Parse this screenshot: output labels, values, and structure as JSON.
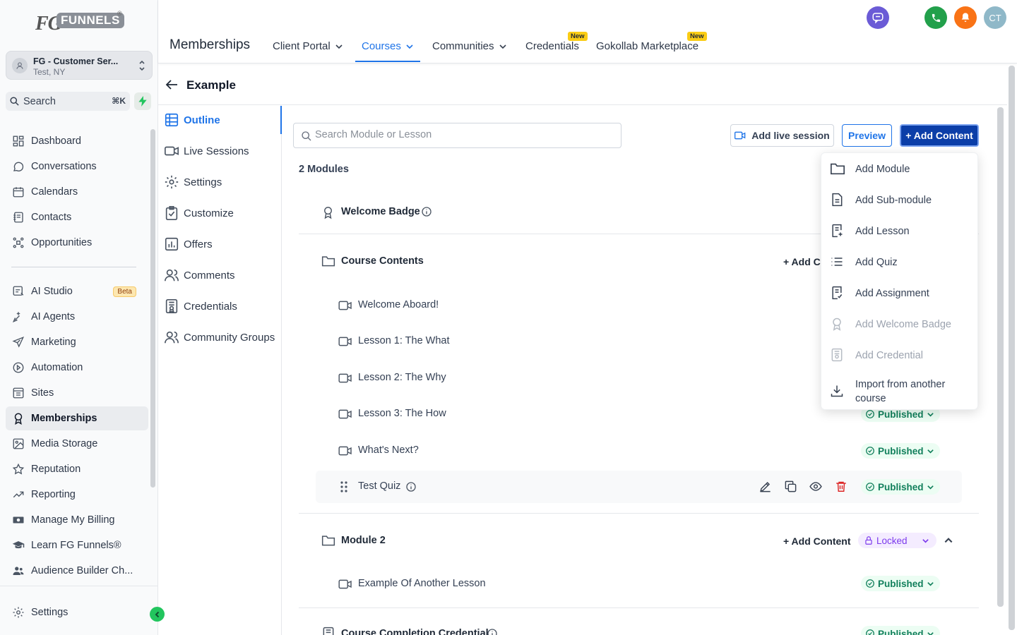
{
  "brand": {
    "fg": "FG",
    "funnels": "FUNNELS",
    "reg": "®"
  },
  "account": {
    "name": "FG - Customer Ser...",
    "location": "Test, NY"
  },
  "sidebar_search": {
    "label": "Search",
    "shortcut": "⌘K"
  },
  "sidebar": {
    "items": [
      {
        "label": "Dashboard",
        "icon": "dashboard-icon"
      },
      {
        "label": "Conversations",
        "icon": "chat-icon"
      },
      {
        "label": "Calendars",
        "icon": "calendar-icon"
      },
      {
        "label": "Contacts",
        "icon": "contacts-icon"
      },
      {
        "label": "Opportunities",
        "icon": "opportunities-icon"
      },
      {
        "label": "AI Studio",
        "icon": "ai-studio-icon",
        "badge": "Beta"
      },
      {
        "label": "AI Agents",
        "icon": "sparkle-icon"
      },
      {
        "label": "Marketing",
        "icon": "send-icon"
      },
      {
        "label": "Automation",
        "icon": "automation-icon"
      },
      {
        "label": "Sites",
        "icon": "sites-icon"
      },
      {
        "label": "Memberships",
        "icon": "award-icon",
        "active": true
      },
      {
        "label": "Media Storage",
        "icon": "image-icon"
      },
      {
        "label": "Reputation",
        "icon": "star-icon"
      },
      {
        "label": "Reporting",
        "icon": "trend-icon"
      },
      {
        "label": "Manage My Billing",
        "icon": "money-icon"
      },
      {
        "label": "Learn FG Funnels®",
        "icon": "graduation-cap-icon"
      },
      {
        "label": "Audience Builder Ch...",
        "icon": "users-icon"
      }
    ],
    "settings": "Settings"
  },
  "topbar": {
    "title": "Memberships",
    "tabs": [
      {
        "label": "Client Portal",
        "dropdown": true
      },
      {
        "label": "Courses",
        "dropdown": true,
        "active": true
      },
      {
        "label": "Communities",
        "dropdown": true
      },
      {
        "label": "Credentials",
        "badge": "New"
      },
      {
        "label": "Gokollab Marketplace",
        "badge": "New"
      }
    ],
    "avatar_initials": "CT",
    "colors": {
      "chat": "#6b5bd6",
      "phone": "#22a04b",
      "bell": "#f97316",
      "avatar": "#8fb8c8"
    }
  },
  "course": {
    "title": "Example",
    "nav": [
      {
        "label": "Outline",
        "icon": "outline-icon",
        "active": true
      },
      {
        "label": "Live Sessions",
        "icon": "video-icon"
      },
      {
        "label": "Settings",
        "icon": "gear-icon"
      },
      {
        "label": "Customize",
        "icon": "clipboard-check-icon"
      },
      {
        "label": "Offers",
        "icon": "chart-bar-icon"
      },
      {
        "label": "Comments",
        "icon": "users-icon"
      },
      {
        "label": "Credentials",
        "icon": "certificate-icon"
      },
      {
        "label": "Community Groups",
        "icon": "users-icon"
      }
    ]
  },
  "toolbar": {
    "search_placeholder": "Search Module or Lesson",
    "live_session": "Add live session",
    "preview": "Preview",
    "add_content": "+ Add Content"
  },
  "outline": {
    "modules_count": "2 Modules",
    "welcome_badge": "Welcome Badge",
    "module1": {
      "title": "Course Contents",
      "add_content": "+ Add Co",
      "lessons": [
        {
          "title": "Welcome Aboard!"
        },
        {
          "title": "Lesson 1: The What"
        },
        {
          "title": "Lesson 2: The Why"
        },
        {
          "title": "Lesson 3: The How",
          "status": "Published"
        },
        {
          "title": "What's Next?",
          "status": "Published"
        },
        {
          "title": "Test Quiz",
          "status": "Published"
        }
      ]
    },
    "module2": {
      "title": "Module 2",
      "add_content": "+ Add Content",
      "status": "Locked",
      "lessons": [
        {
          "title": "Example Of Another Lesson",
          "status": "Published"
        }
      ]
    },
    "credential": {
      "title": "Course Completion Credential",
      "status": "Published"
    }
  },
  "add_menu": {
    "items": [
      {
        "label": "Add Module",
        "icon": "folder-icon"
      },
      {
        "label": "Add Sub-module",
        "icon": "document-icon"
      },
      {
        "label": "Add Lesson",
        "icon": "lesson-add-icon"
      },
      {
        "label": "Add Quiz",
        "icon": "list-icon"
      },
      {
        "label": "Add Assignment",
        "icon": "assignment-icon"
      },
      {
        "label": "Add Welcome Badge",
        "icon": "award-icon",
        "disabled": true
      },
      {
        "label": "Add Credential",
        "icon": "certificate-icon",
        "disabled": true
      },
      {
        "label": "Import from another course",
        "icon": "download-icon"
      }
    ]
  }
}
